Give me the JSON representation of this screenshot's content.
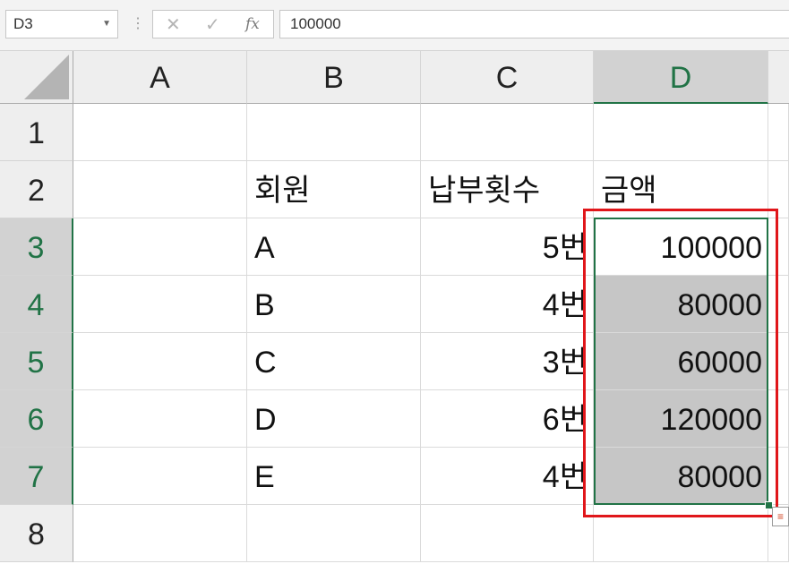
{
  "name_box": {
    "value": "D3",
    "dropdown_icon": "chevron-down-icon"
  },
  "formula_bar": {
    "cancel_icon": "✕",
    "enter_icon": "✓",
    "fx_label": "fx",
    "value": "100000"
  },
  "columns": [
    "A",
    "B",
    "C",
    "D"
  ],
  "rows": [
    "1",
    "2",
    "3",
    "4",
    "5",
    "6",
    "7",
    "8"
  ],
  "cells": {
    "B2": "회원",
    "C2": "납부횟수",
    "D2": "금액",
    "B3": "A",
    "C3": "5번",
    "D3": "100000",
    "B4": "B",
    "C4": "4번",
    "D4": "80000",
    "B5": "C",
    "C5": "3번",
    "D5": "60000",
    "B6": "D",
    "C6": "6번",
    "D6": "120000",
    "B7": "E",
    "C7": "4번",
    "D7": "80000"
  },
  "selection": {
    "active_cell": "D3",
    "range": "D3:D7"
  },
  "colors": {
    "accent": "#217346",
    "highlight_border": "#e0161a",
    "selection_fill": "#c6c6c6"
  }
}
